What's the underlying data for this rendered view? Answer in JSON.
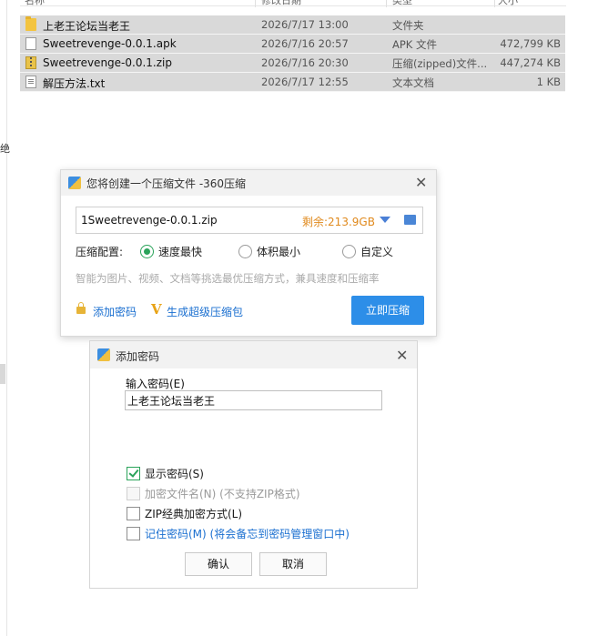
{
  "side": {
    "partial_char": "绝"
  },
  "file_list": {
    "headers": {
      "name": "名称",
      "date": "修改日期",
      "type": "类型",
      "size": "大小"
    },
    "rows": [
      {
        "icon": "folder-icon",
        "name": "上老王论坛当老王",
        "date": "2026/7/17 13:00",
        "type": "文件夹",
        "size": ""
      },
      {
        "icon": "apk-file-icon",
        "name": "Sweetrevenge-0.0.1.apk",
        "date": "2026/7/16 20:57",
        "type": "APK 文件",
        "size": "472,799 KB"
      },
      {
        "icon": "zip-file-icon",
        "name": "Sweetrevenge-0.0.1.zip",
        "date": "2026/7/16 20:30",
        "type": "压缩(zipped)文件...",
        "size": "447,274 KB"
      },
      {
        "icon": "text-file-icon",
        "name": "解压方法.txt",
        "date": "2026/7/17 12:55",
        "type": "文本文档",
        "size": "1 KB"
      }
    ]
  },
  "compress_dialog": {
    "title": "您将创建一个压缩文件 -360压缩",
    "close": "✕",
    "path_value": "1Sweetrevenge-0.0.1.zip",
    "remaining": "剩余:213.9GB",
    "config_label": "压缩配置:",
    "options": [
      {
        "label": "速度最快",
        "selected": true
      },
      {
        "label": "体积最小",
        "selected": false
      },
      {
        "label": "自定义",
        "selected": false
      }
    ],
    "hint": "智能为图片、视频、文档等挑选最优压缩方式，兼具速度和压缩率",
    "add_password": "添加密码",
    "super_pack": "生成超级压缩包",
    "compress_button": "立即压缩",
    "accent": "#2d8ee8"
  },
  "password_dialog": {
    "title": "添加密码",
    "close": "✕",
    "input_label": "输入密码(E)",
    "input_value": "上老王论坛当老王",
    "checkboxes": [
      {
        "label": "显示密码(S)",
        "checked": true,
        "disabled": false,
        "color": "#111111"
      },
      {
        "label": "加密文件名(N) (不支持ZIP格式)",
        "checked": false,
        "disabled": true,
        "color": "#9a9a9a"
      },
      {
        "label": "ZIP经典加密方式(L)",
        "checked": false,
        "disabled": false,
        "color": "#111111"
      },
      {
        "label": "记住密码(M) (将会备忘到密码管理窗口中)",
        "checked": false,
        "disabled": false,
        "color": "#1a6fd0"
      }
    ],
    "ok": "确认",
    "cancel": "取消"
  }
}
